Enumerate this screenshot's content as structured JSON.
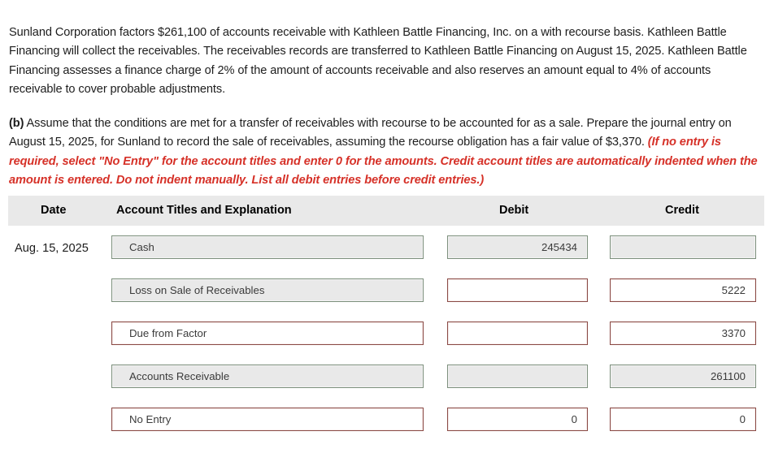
{
  "intro": {
    "text": "Sunland Corporation factors $261,100 of accounts receivable with Kathleen Battle Financing, Inc. on a with recourse basis. Kathleen Battle Financing will collect the receivables. The receivables records are transferred to Kathleen Battle Financing on August 15, 2025. Kathleen Battle Financing assesses a finance charge of 2% of the amount of accounts receivable and also reserves an amount equal to 4% of accounts receivable to cover probable adjustments."
  },
  "question": {
    "label": "(b)",
    "body": " Assume that the conditions are met for a transfer of receivables with recourse to be accounted for as a sale. Prepare the journal entry on August 15, 2025, for Sunland to record the sale of receivables, assuming the recourse obligation has a fair value of $3,370. ",
    "instruction": "(If no entry is required, select \"No Entry\" for the account titles and enter 0 for the amounts. Credit account titles are automatically indented when the amount is entered. Do not indent manually. List all debit entries before credit entries.)"
  },
  "table": {
    "headers": {
      "date": "Date",
      "account": "Account Titles and Explanation",
      "debit": "Debit",
      "credit": "Credit"
    },
    "rows": [
      {
        "date": "Aug. 15, 2025",
        "account": "Cash",
        "account_state": "filled",
        "debit": "245434",
        "debit_state": "filled",
        "credit": "",
        "credit_state": "filled"
      },
      {
        "date": "",
        "account": "Loss on Sale of Receivables",
        "account_state": "filled",
        "debit": "",
        "debit_state": "error",
        "credit": "5222",
        "credit_state": "error"
      },
      {
        "date": "",
        "account": "Due from Factor",
        "account_state": "error",
        "debit": "",
        "debit_state": "error",
        "credit": "3370",
        "credit_state": "error"
      },
      {
        "date": "",
        "account": "Accounts Receivable",
        "account_state": "filled",
        "debit": "",
        "debit_state": "filled",
        "credit": "261100",
        "credit_state": "filled"
      },
      {
        "date": "",
        "account": "No Entry",
        "account_state": "error",
        "debit": "0",
        "debit_state": "error",
        "credit": "0",
        "credit_state": "error"
      }
    ]
  },
  "colors": {
    "header_band": "#e9e9e9",
    "instruction_red": "#d63128",
    "field_filled_border": "#7c8f7c",
    "field_error_border": "#8a4a45",
    "field_filled_bg": "#e9e9e9",
    "field_error_bg": "#ffffff"
  }
}
